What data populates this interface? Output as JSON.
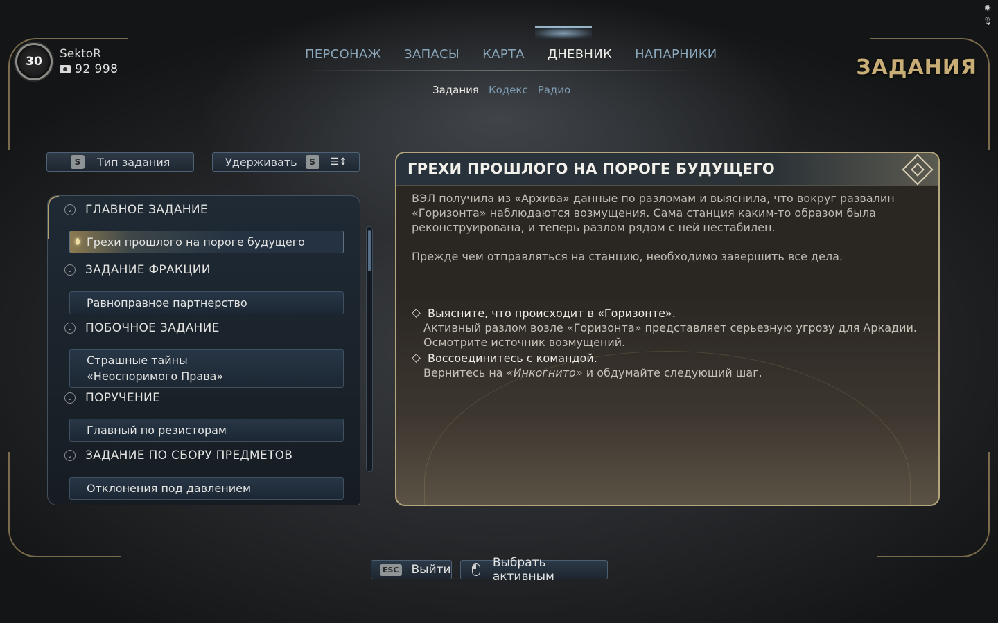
{
  "player": {
    "level": "30",
    "name": "SektoR",
    "credits": "92 998"
  },
  "nav": {
    "tabs": [
      {
        "label": "ПЕРСОНАЖ"
      },
      {
        "label": "ЗАПАСЫ"
      },
      {
        "label": "КАРТА"
      },
      {
        "label": "ДНЕВНИК",
        "active": true
      },
      {
        "label": "НАПАРНИКИ"
      }
    ],
    "subtabs": [
      {
        "label": "Задания",
        "active": true
      },
      {
        "label": "Кодекс"
      },
      {
        "label": "Радио"
      }
    ]
  },
  "page_title": "ЗАДАНИЯ",
  "filters": {
    "type_key": "S",
    "type_label": "Тип задания",
    "hold_label": "Удерживать",
    "hold_key": "S"
  },
  "quest_list": {
    "categories": [
      {
        "title": "ГЛАВНОЕ ЗАДАНИЕ",
        "items": [
          "Грехи прошлого на пороге будущего"
        ]
      },
      {
        "title": "ЗАДАНИЕ ФРАКЦИИ",
        "items": [
          "Равноправное партнерство"
        ]
      },
      {
        "title": "ПОБОЧНОЕ ЗАДАНИЕ",
        "items": [
          "Страшные тайны «Неоспоримого Права»"
        ]
      },
      {
        "title": "ПОРУЧЕНИЕ",
        "items": [
          "Главный по резисторам"
        ]
      },
      {
        "title": "ЗАДАНИЕ ПО СБОРУ ПРЕДМЕТОВ",
        "items": [
          "Отклонения под давлением"
        ]
      }
    ]
  },
  "detail": {
    "title": "ГРЕХИ ПРОШЛОГО НА ПОРОГЕ БУДУЩЕГО",
    "description_1": "ВЭЛ получила из «Архива» данные по разломам и выяснила, что вокруг развалин «Горизонта» наблюдаются возмущения. Сама станция каким-то образом была реконструирована, и теперь разлом рядом с ней нестабилен.",
    "description_2": "Прежде чем отправляться на станцию, необходимо завершить все дела.",
    "objectives": [
      {
        "title": "Выясните, что происходит в «Горизонте».",
        "desc": "Активный разлом возле «Горизонта» представляет серьезную угрозу для Аркадии. Осмотрите источник возмущений."
      },
      {
        "title": "Воссоединитесь с командой.",
        "desc_prefix": "Вернитесь на ",
        "desc_italic": "«Инкогнито»",
        "desc_suffix": " и обдумайте следующий шаг."
      }
    ]
  },
  "bottom": {
    "exit_key": "ESC",
    "exit_label": "Выйти",
    "set_active_label": "Выбрать активным"
  }
}
